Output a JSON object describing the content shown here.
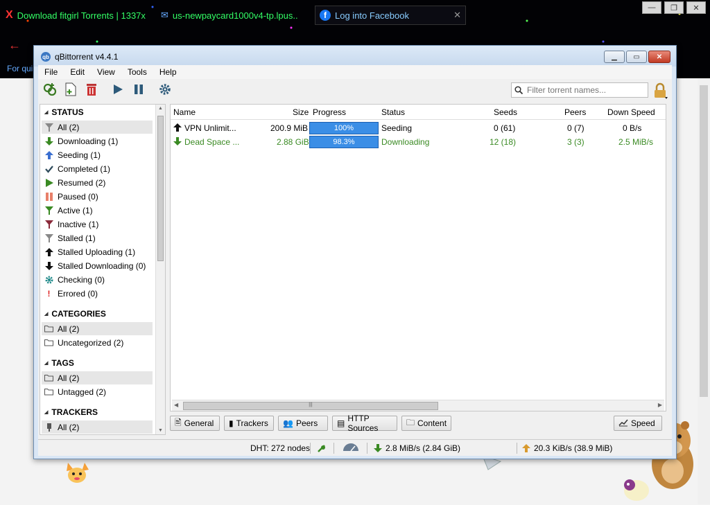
{
  "browser": {
    "tabs": [
      {
        "label": "Download fitgirl Torrents | 1337x"
      },
      {
        "label": "us-newpaycard1000v4-tp.lpus.."
      },
      {
        "label": "Log into Facebook"
      }
    ],
    "banner_text": "For qui"
  },
  "window": {
    "title": "qBittorrent v4.4.1"
  },
  "menu": [
    "File",
    "Edit",
    "View",
    "Tools",
    "Help"
  ],
  "search": {
    "placeholder": "Filter torrent names..."
  },
  "sidebar": {
    "status_header": "STATUS",
    "status_items": [
      {
        "label": "All (2)",
        "icon": "funnel-gray-icon",
        "selected": true
      },
      {
        "label": "Downloading (1)",
        "icon": "arrow-down-green-icon"
      },
      {
        "label": "Seeding (1)",
        "icon": "arrow-up-blue-icon"
      },
      {
        "label": "Completed (1)",
        "icon": "checkmark-icon"
      },
      {
        "label": "Resumed (2)",
        "icon": "play-green-icon"
      },
      {
        "label": "Paused (0)",
        "icon": "pause-orange-icon"
      },
      {
        "label": "Active (1)",
        "icon": "funnel-green-icon"
      },
      {
        "label": "Inactive (1)",
        "icon": "funnel-red-icon"
      },
      {
        "label": "Stalled (1)",
        "icon": "funnel-gray-icon"
      },
      {
        "label": "Stalled Uploading (1)",
        "icon": "arrow-up-black-icon"
      },
      {
        "label": "Stalled Downloading (0)",
        "icon": "arrow-down-black-icon"
      },
      {
        "label": "Checking (0)",
        "icon": "gear-teal-icon"
      },
      {
        "label": "Errored (0)",
        "icon": "exclamation-red-icon"
      }
    ],
    "categories_header": "CATEGORIES",
    "categories_items": [
      {
        "label": "All (2)",
        "selected": true
      },
      {
        "label": "Uncategorized (2)"
      }
    ],
    "tags_header": "TAGS",
    "tags_items": [
      {
        "label": "All (2)",
        "selected": true
      },
      {
        "label": "Untagged (2)"
      }
    ],
    "trackers_header": "TRACKERS",
    "trackers_items": [
      {
        "label": "All (2)",
        "selected": true
      }
    ]
  },
  "table": {
    "columns": [
      "Name",
      "Size",
      "Progress",
      "Status",
      "Seeds",
      "Peers",
      "Down Speed"
    ],
    "rows": [
      {
        "name": "VPN Unlimit...",
        "size": "200.9 MiB",
        "progress": "100%",
        "progress_value": 1.0,
        "status": "Seeding",
        "seeds": "0 (61)",
        "peers": "0 (7)",
        "down_speed": "0 B/s",
        "state": "seeding"
      },
      {
        "name": "Dead Space ...",
        "size": "2.88 GiB",
        "progress": "98.3%",
        "progress_value": 0.983,
        "status": "Downloading",
        "seeds": "12 (18)",
        "peers": "3 (3)",
        "down_speed": "2.5 MiB/s",
        "state": "downloading"
      }
    ]
  },
  "bottom_tabs": [
    "General",
    "Trackers",
    "Peers",
    "HTTP Sources",
    "Content"
  ],
  "speed_button": "Speed",
  "statusbar": {
    "dht": "DHT: 272 nodes",
    "download": "2.8 MiB/s (2.84 GiB)",
    "upload": "20.3 KiB/s (38.9 MiB)"
  },
  "colors": {
    "progress": "#3b8ee6",
    "downloading": "#3a8a23",
    "close": "#c23b24"
  }
}
